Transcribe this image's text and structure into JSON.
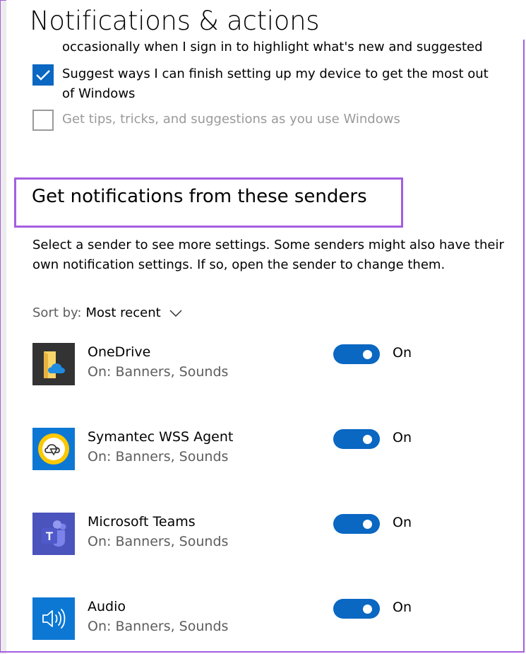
{
  "page": {
    "title": "Notifications & actions"
  },
  "tips": {
    "cut_text": "occasionally when I sign in to highlight what's new and suggested",
    "items": [
      {
        "label": "Suggest ways I can finish setting up my device to get the most out of Windows",
        "checked": true,
        "enabled": true
      },
      {
        "label": "Get tips, tricks, and suggestions as you use Windows",
        "checked": false,
        "enabled": false
      }
    ]
  },
  "senders_section": {
    "heading": "Get notifications from these senders",
    "description": "Select a sender to see more settings. Some senders might also have their own notification settings. If so, open the sender to change them.",
    "sort_label": "Sort by:",
    "sort_value": "Most recent"
  },
  "senders": [
    {
      "name": "OneDrive",
      "detail": "On: Banners, Sounds",
      "toggle_on": true,
      "state": "On",
      "icon": "onedrive-icon"
    },
    {
      "name": "Symantec WSS Agent",
      "detail": "On: Banners, Sounds",
      "toggle_on": true,
      "state": "On",
      "icon": "symantec-icon"
    },
    {
      "name": "Microsoft Teams",
      "detail": "On: Banners, Sounds",
      "toggle_on": true,
      "state": "On",
      "icon": "teams-icon"
    },
    {
      "name": "Audio",
      "detail": "On: Banners, Sounds",
      "toggle_on": true,
      "state": "On",
      "icon": "speaker-icon"
    }
  ],
  "colors": {
    "accent": "#0a67c2",
    "highlight": "#a45ee0",
    "secondary_text": "#5d5d5d"
  }
}
